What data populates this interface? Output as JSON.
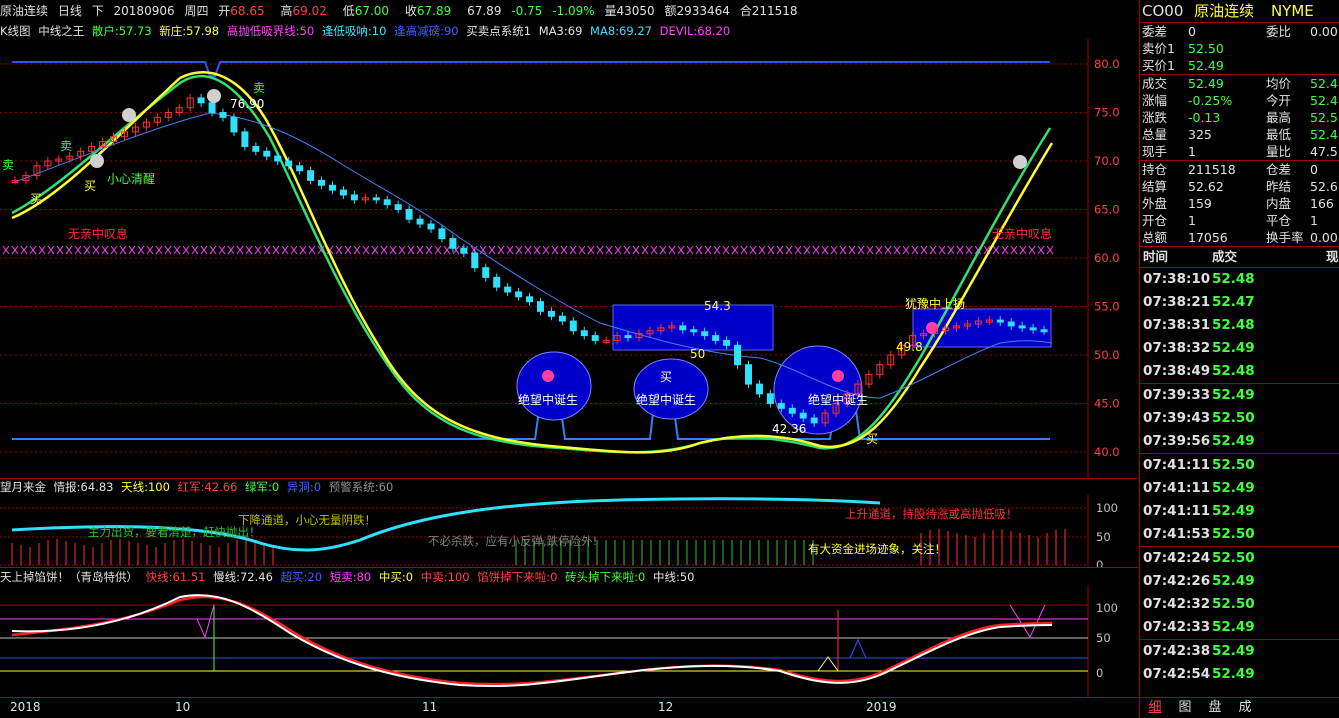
{
  "topbar": {
    "name": "原油连续",
    "period": "日线",
    "dir": "下",
    "date": "20180906",
    "weekday": "周四",
    "open_label": "开",
    "open": "68.65",
    "high_label": "高",
    "high": "69.02",
    "low_label": "低",
    "low": "67.00",
    "close_label": "收",
    "close": "67.89",
    "price": "67.89",
    "chg": "-0.75",
    "pct": "-1.09%",
    "vol": "量43050",
    "amt": "额2933464",
    "oi": "合211518"
  },
  "main_indicators": {
    "label": "K线图",
    "sys1": "中线之王",
    "sanhu": "散户:57.73",
    "xinzhuang": "新庄:57.98",
    "gaopao": "高抛低吸界线:50",
    "fengdi": "逢低吸呐:10",
    "fenggao": "逢高减磅:90",
    "mmsys": "买卖点系统1",
    "ma3": "MA3:69",
    "ma8": "MA8:69.27",
    "devil": "DEVIL:68.20"
  },
  "annotations": {
    "sell1": "卖",
    "sell2": "卖",
    "sell3": "卖",
    "buy1": "买",
    "buy2": "买",
    "buy3": "买",
    "buy4": "买",
    "caution": "小心清醒",
    "wuqin_left": "无亲中叹息",
    "wuqin_right": "无亲中叹息",
    "hope1": "绝望中诞生",
    "hope2": "绝望中诞生",
    "hope3": "绝望中诞生",
    "hesitate": "犹豫中上扬",
    "peak": "76.90",
    "low_label": "42.36",
    "box1_top": "54.3",
    "box1_bot": "50",
    "val498": "49.8"
  },
  "price_axis": [
    "80.0",
    "75.0",
    "70.0",
    "65.0",
    "60.0",
    "55.0",
    "50.0",
    "45.0",
    "40.0"
  ],
  "mid_indicators": {
    "label": "望月来金",
    "info": "情报:64.83",
    "tianxian": "天线:100",
    "hongjun": "红军:42.66",
    "lvjun": "绿军:0",
    "yidong": "异洞:0",
    "yujing": "预警系统:60"
  },
  "mid_texts": {
    "t1": "下降通道，小心无量阴跌！",
    "t2": "上升通道，持股待涨或高抛低吸！",
    "t3": "有大资金进场迹象，关注！",
    "t4": "不必杀跌，应有小反弹,跌停险外!",
    "t5": "主力出货，要看清楚，赶快抛出！"
  },
  "mid_axis": [
    "100",
    "50",
    "0"
  ],
  "low_indicators": {
    "label": "天上掉馅饼！（青岛特供）",
    "kuai": "快线:61.51",
    "man": "慢线:72.46",
    "chaomai": "超买:20",
    "duanmai": "短卖:80",
    "zhongmai": "中买:0",
    "zhongmai2": "中卖:100",
    "xianbing": "馅饼掉下来啦:0",
    "zhuantou": "砖头掉下来啦:0",
    "zhongxian": "中线:50"
  },
  "low_axis": [
    "100",
    "50",
    "0"
  ],
  "time_axis": [
    "2018",
    "10",
    "11",
    "12",
    "2019"
  ],
  "quote": {
    "code": "CO00",
    "name": "原油连续",
    "exch": "NYME",
    "rows": [
      [
        "委差",
        "0",
        "委比",
        "0.00"
      ],
      [
        "卖价1",
        "52.50",
        "",
        ""
      ],
      [
        "买价1",
        "52.49",
        "",
        ""
      ],
      [
        "成交",
        "52.49",
        "均价",
        "52.4"
      ],
      [
        "涨幅",
        "-0.25%",
        "今开",
        "52.4"
      ],
      [
        "涨跌",
        "-0.13",
        "最高",
        "52.5"
      ],
      [
        "总量",
        "325",
        "最低",
        "52.4"
      ],
      [
        "现手",
        "1",
        "量比",
        "47.5"
      ],
      [
        "持仓",
        "211518",
        "仓差",
        "0"
      ],
      [
        "结算",
        "52.62",
        "昨结",
        "52.6"
      ],
      [
        "外盘",
        "159",
        "内盘",
        "166"
      ],
      [
        "开仓",
        "1",
        "平仓",
        "1"
      ],
      [
        "总额",
        "17056",
        "换手率",
        "0.00"
      ]
    ],
    "colors": [
      [
        "w",
        "w",
        "w",
        "w"
      ],
      [
        "w",
        "g",
        "",
        ""
      ],
      [
        "w",
        "g",
        "",
        ""
      ],
      [
        "w",
        "g",
        "w",
        "g"
      ],
      [
        "w",
        "g",
        "w",
        "g"
      ],
      [
        "w",
        "g",
        "w",
        "g"
      ],
      [
        "w",
        "w",
        "w",
        "g"
      ],
      [
        "w",
        "w",
        "w",
        "w"
      ],
      [
        "w",
        "w",
        "w",
        "w"
      ],
      [
        "w",
        "w",
        "w",
        "w"
      ],
      [
        "w",
        "w",
        "w",
        "w"
      ],
      [
        "w",
        "w",
        "w",
        "w"
      ],
      [
        "w",
        "w",
        "w",
        "w"
      ]
    ]
  },
  "ticks": {
    "header": [
      "时间",
      "成交",
      "现"
    ],
    "rows": [
      [
        "07:38:10",
        "52.48"
      ],
      [
        "07:38:21",
        "52.47"
      ],
      [
        "07:38:31",
        "52.48"
      ],
      [
        "07:38:32",
        "52.49"
      ],
      [
        "07:38:49",
        "52.48"
      ],
      [
        "07:39:33",
        "52.49"
      ],
      [
        "07:39:43",
        "52.50"
      ],
      [
        "07:39:56",
        "52.49"
      ],
      [
        "07:41:11",
        "52.50"
      ],
      [
        "07:41:11",
        "52.49"
      ],
      [
        "07:41:11",
        "52.49"
      ],
      [
        "07:41:53",
        "52.50"
      ],
      [
        "07:42:24",
        "52.50"
      ],
      [
        "07:42:26",
        "52.49"
      ],
      [
        "07:42:32",
        "52.50"
      ],
      [
        "07:42:33",
        "52.49"
      ],
      [
        "07:42:38",
        "52.49"
      ],
      [
        "07:42:54",
        "52.49"
      ]
    ]
  },
  "tabs": [
    "细",
    "图",
    "盘",
    "成"
  ],
  "colors": {
    "up": "#ff3030",
    "down": "#30e0ff",
    "grid": "#a00000",
    "yellow": "#ffff40",
    "green": "#40ff80"
  }
}
